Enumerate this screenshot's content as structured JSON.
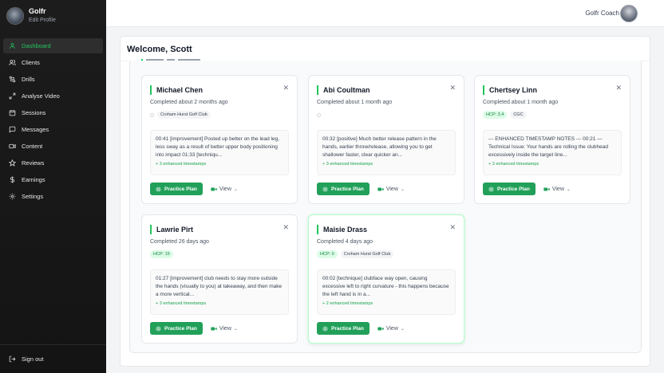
{
  "sidebar": {
    "app_name": "Golfr",
    "edit_profile": "Edit Profile",
    "items": [
      {
        "label": "Dashboard",
        "icon": "user-icon",
        "active": true
      },
      {
        "label": "Clients",
        "icon": "users-icon"
      },
      {
        "label": "Drills",
        "icon": "drills-icon"
      },
      {
        "label": "Analyse Video",
        "icon": "expand-icon"
      },
      {
        "label": "Sessions",
        "icon": "calendar-icon"
      },
      {
        "label": "Messages",
        "icon": "message-icon"
      },
      {
        "label": "Content",
        "icon": "video-icon"
      },
      {
        "label": "Reviews",
        "icon": "star-icon"
      },
      {
        "label": "Earnings",
        "icon": "dollar-icon"
      },
      {
        "label": "Settings",
        "icon": "gear-icon"
      }
    ],
    "sign_out": "Sign out"
  },
  "topbar": {
    "coach_name": "Golfr Coach"
  },
  "main": {
    "welcome": "Welcome, Scott"
  },
  "accent": "#22a05a",
  "cards": [
    {
      "name": "Michael Chen",
      "completed": "Completed about 2 months ago",
      "hcp": "",
      "club": "Croham Hurst Golf Club",
      "notes": "00:41 [improvement] Posted up better on the lead leg, less sway as a result of better upper body positioning into impact 01:33 [techniqu...",
      "enhanced": "+ 3 enhanced timestamps",
      "plan_label": "Practice Plan",
      "view_label": "View"
    },
    {
      "name": "Abi Coultman",
      "completed": "Completed about 1 month ago",
      "hcp": "",
      "club": "",
      "notes": "00:32 [positive] Much better release pattern in the hands, earlier throw/release, allowing you to get shallower faster, clear quicker an...",
      "enhanced": "+ 3 enhanced timestamps",
      "plan_label": "Practice Plan",
      "view_label": "View"
    },
    {
      "name": "Chertsey Linn",
      "completed": "Completed about 1 month ago",
      "hcp": "HCP: 3.4",
      "club": "CGC",
      "notes": "--- ENHANCED TIMESTAMP NOTES --- 00:21 — Technical Issue: Your hands are rolling the clubhead excessively inside the target line...",
      "enhanced": "+ 3 enhanced timestamps",
      "plan_label": "Practice Plan",
      "view_label": "View"
    },
    {
      "name": "Lawrie Pirt",
      "completed": "Completed 26 days ago",
      "hcp": "HCP: 15",
      "club": "",
      "notes": "01:27 [improvement] club needs to stay more outside the hands (visually to you) at takeaway, and then make a more vertical...",
      "enhanced": "+ 3 enhanced timestamps",
      "plan_label": "Practice Plan",
      "view_label": "View"
    },
    {
      "name": "Maisie Drass",
      "completed": "Completed 4 days ago",
      "hcp": "HCP: 0",
      "club": "Croham Hurst Golf Club",
      "notes": "00:02 [technique] clubface way open, causing excessive left to right curvature - this happens because the left hand is in a...",
      "enhanced": "+ 2 enhanced timestamps",
      "plan_label": "Practice Plan",
      "view_label": "View"
    }
  ]
}
